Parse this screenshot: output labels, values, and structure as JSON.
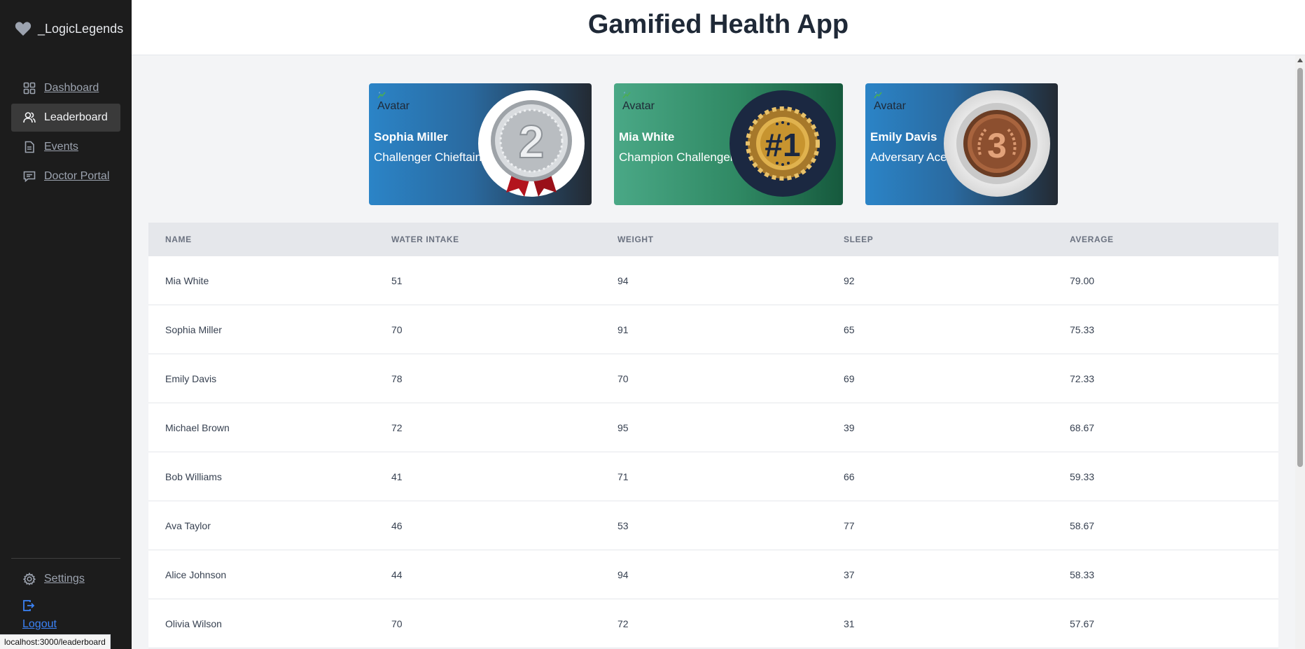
{
  "sidebar": {
    "brand": "_LogicLegends",
    "nav": [
      {
        "label": "Dashboard",
        "icon": "grid-icon"
      },
      {
        "label": "Leaderboard",
        "icon": "users-icon",
        "active": true
      },
      {
        "label": "Events",
        "icon": "document-icon"
      },
      {
        "label": "Doctor Portal",
        "icon": "chat-icon"
      }
    ],
    "settings_label": "Settings",
    "logout_label": "Logout"
  },
  "header": {
    "title": "Gamified Health App"
  },
  "podium": [
    {
      "avatar_alt": "Avatar",
      "name": "Sophia Miller",
      "title": "Challenger Chieftain",
      "rank": "2",
      "medal": "silver"
    },
    {
      "avatar_alt": "Avatar",
      "name": "Mia White",
      "title": "Champion Challenger",
      "rank": "#1",
      "medal": "gold"
    },
    {
      "avatar_alt": "Avatar",
      "name": "Emily Davis",
      "title": "Adversary Ace",
      "rank": "3",
      "medal": "bronze"
    }
  ],
  "table": {
    "headers": [
      "NAME",
      "WATER INTAKE",
      "WEIGHT",
      "SLEEP",
      "AVERAGE"
    ],
    "rows": [
      [
        "Mia White",
        "51",
        "94",
        "92",
        "79.00"
      ],
      [
        "Sophia Miller",
        "70",
        "91",
        "65",
        "75.33"
      ],
      [
        "Emily Davis",
        "78",
        "70",
        "69",
        "72.33"
      ],
      [
        "Michael Brown",
        "72",
        "95",
        "39",
        "68.67"
      ],
      [
        "Bob Williams",
        "41",
        "71",
        "66",
        "59.33"
      ],
      [
        "Ava Taylor",
        "46",
        "53",
        "77",
        "58.67"
      ],
      [
        "Alice Johnson",
        "44",
        "94",
        "37",
        "58.33"
      ],
      [
        "Olivia Wilson",
        "70",
        "72",
        "31",
        "57.67"
      ]
    ]
  },
  "status_url": "localhost:3000/leaderboard",
  "colors": {
    "sidebar_bg": "#1c1c1c",
    "accent_blue": "#3b82f6",
    "gold": "#d4a544",
    "silver": "#c0c0c0",
    "bronze": "#b5714a"
  }
}
